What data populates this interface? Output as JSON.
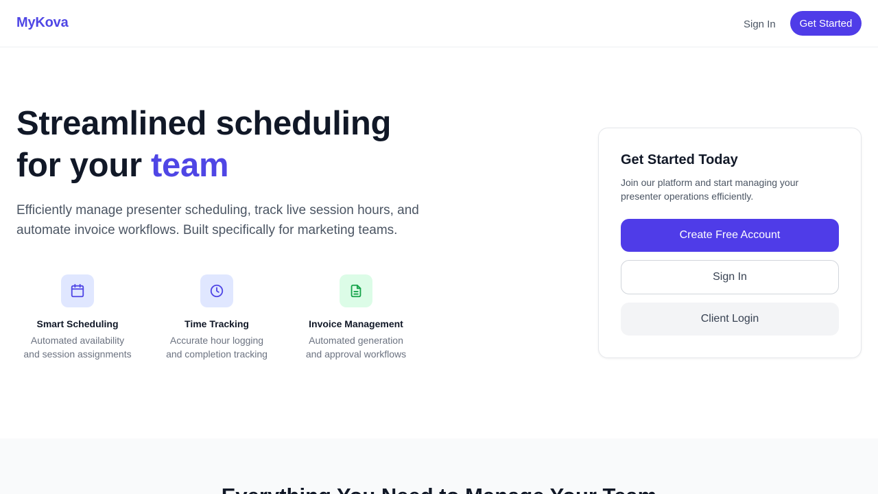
{
  "brand": {
    "name": "MyKova"
  },
  "nav": {
    "sign_in": "Sign In",
    "get_started": "Get Started"
  },
  "hero": {
    "title_line1": "Streamlined scheduling",
    "title_line2_prefix": "for your ",
    "title_line2_accent": "team",
    "subtitle": "Efficiently manage presenter scheduling, track live session hours, and automate invoice workflows. Built specifically for marketing teams."
  },
  "features": [
    {
      "icon": "calendar-icon",
      "title": "Smart Scheduling",
      "description": "Automated availability and session assignments"
    },
    {
      "icon": "clock-icon",
      "title": "Time Tracking",
      "description": "Accurate hour logging and completion tracking"
    },
    {
      "icon": "document-icon",
      "title": "Invoice Management",
      "description": "Automated generation and approval workflows"
    }
  ],
  "card": {
    "title": "Get Started Today",
    "description": "Join our platform and start managing your presenter operations efficiently.",
    "create_account": "Create Free Account",
    "sign_in": "Sign In",
    "client_login": "Client Login"
  },
  "section": {
    "title": "Everything You Need to Manage Your Team"
  },
  "colors": {
    "accent": "#4f46e5",
    "button": "#4f3ce8",
    "green_icon": "#16a34a"
  }
}
